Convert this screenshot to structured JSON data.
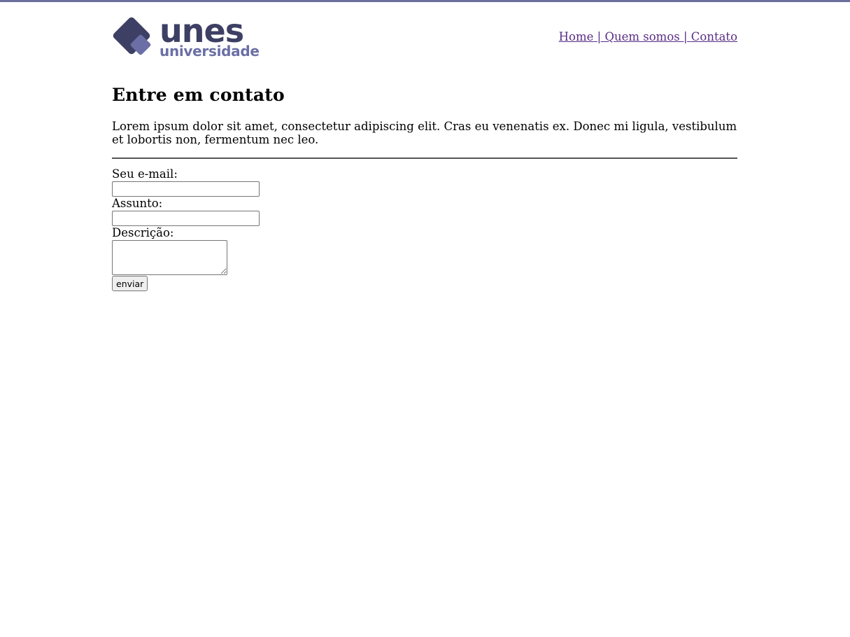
{
  "brand": {
    "name": "unes",
    "tagline": "universidade",
    "colors": {
      "dark": "#3d3f64",
      "light": "#6b6fa6"
    }
  },
  "nav": {
    "items": [
      {
        "label": "Home | "
      },
      {
        "label": "Quem somos | "
      },
      {
        "label": "Contato"
      }
    ]
  },
  "main": {
    "title": "Entre em contato",
    "intro": "Lorem ipsum dolor sit amet, consectetur adipiscing elit. Cras eu venenatis ex. Donec mi ligula, vestibulum et lobortis non, fermentum nec leo."
  },
  "form": {
    "email_label": "Seu e-mail:",
    "email_value": "",
    "subject_label": "Assunto:",
    "subject_value": "",
    "description_label": "Descrição:",
    "description_value": "",
    "submit_label": "enviar"
  }
}
